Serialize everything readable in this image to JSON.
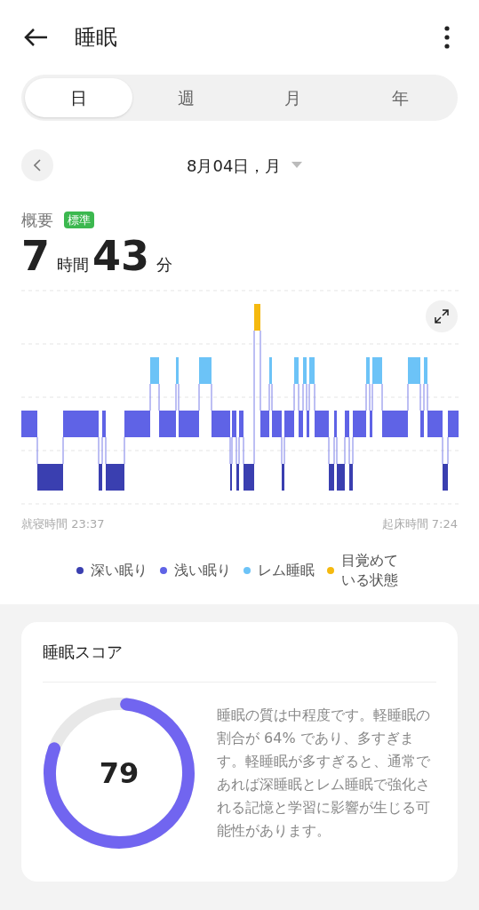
{
  "header": {
    "title": "睡眠"
  },
  "tabs": [
    {
      "label": "日",
      "selected": true
    },
    {
      "label": "週",
      "selected": false
    },
    {
      "label": "月",
      "selected": false
    },
    {
      "label": "年",
      "selected": false
    }
  ],
  "date": "8月04日，月",
  "summary": {
    "title": "概要",
    "badge": "標準",
    "hours": "7",
    "hours_unit": "時間",
    "minutes": "43",
    "minutes_unit": "分"
  },
  "chart": {
    "bedtime": "就寝時間 23:37",
    "wake_time": "起床時間 7:24"
  },
  "legend": [
    {
      "label": "深い眠り",
      "color": "#3a3fb0"
    },
    {
      "label": "浅い眠り",
      "color": "#5f63e6"
    },
    {
      "label": "レム睡眠",
      "color": "#6cc3f7"
    },
    {
      "label": "目覚めている状態",
      "color": "#f5b90f"
    }
  ],
  "score": {
    "title": "睡眠スコア",
    "value": "79",
    "level": 0.79,
    "text": "睡眠の質は中程度です。軽睡眠の割合が 64% であり、多すぎます。軽睡眠が多すぎると、通常であれば深睡眠とレム睡眠で強化される記憶と学習に影響が生じる可能性があります。"
  }
}
